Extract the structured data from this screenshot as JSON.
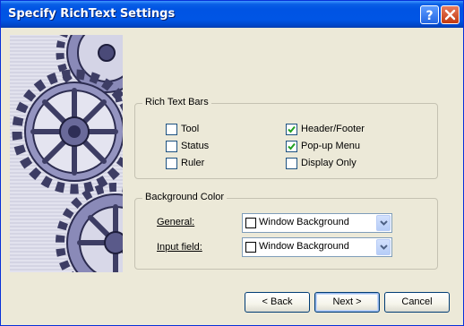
{
  "window": {
    "title": "Specify RichText Settings"
  },
  "title_buttons": [
    {
      "name": "help",
      "icon": "help-icon"
    },
    {
      "name": "close",
      "icon": "close-icon"
    }
  ],
  "rich_text_bars": {
    "legend": "Rich Text Bars",
    "options": [
      {
        "label": "Tool",
        "checked": false
      },
      {
        "label": "Status",
        "checked": false
      },
      {
        "label": "Ruler",
        "checked": false
      },
      {
        "label": "Header/Footer",
        "checked": true
      },
      {
        "label": "Pop-up Menu",
        "checked": true
      },
      {
        "label": "Display Only",
        "checked": false
      }
    ]
  },
  "background_color": {
    "legend": "Background Color",
    "general": {
      "label": "General:",
      "value": "Window Background"
    },
    "input_field": {
      "label": "Input field:",
      "value": "Window Background"
    }
  },
  "buttons": {
    "back": "< Back",
    "next": "Next >",
    "cancel": "Cancel"
  },
  "colors": {
    "dialog_bg": "#ece9d8",
    "titlebar": "#0054e3",
    "checkmark": "#21a121",
    "button_border": "#003c74",
    "close_button": "#c2390f"
  }
}
